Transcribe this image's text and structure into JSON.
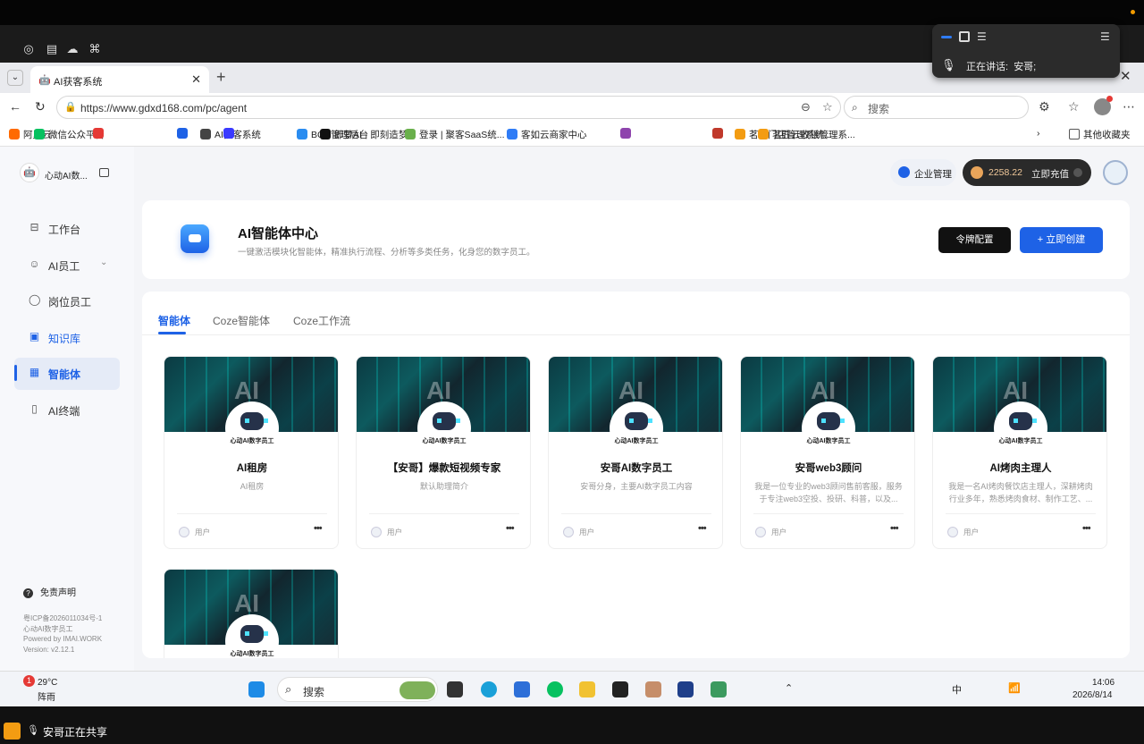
{
  "voice_popup": {
    "speaking_label": "正在讲话:",
    "speaker": "安哥;"
  },
  "tab": {
    "title": "AI获客系统"
  },
  "address": {
    "url": "https://www.gdxd168.com/pc/agent",
    "search_placeholder": "搜索"
  },
  "bookmarks": [
    {
      "label": "阿里云",
      "color": "#ff6a00"
    },
    {
      "label": "微信公众平台",
      "color": "#07c160"
    },
    {
      "label": "",
      "color": "#e53935"
    },
    {
      "label": "",
      "color": "#1e62e6"
    },
    {
      "label": "AI获客系统",
      "color": "#444"
    },
    {
      "label": "",
      "color": "#3a3aff"
    },
    {
      "label": "BCD管理后台",
      "color": "#2a8cf0"
    },
    {
      "label": "即梦AI - 即刻造梦",
      "color": "#111"
    },
    {
      "label": "登录 | 聚客SaaS统...",
      "color": "#6ab04c"
    },
    {
      "label": "客如云商家中心",
      "color": "#2f7cf6"
    },
    {
      "label": "",
      "color": "#8e44ad"
    },
    {
      "label": "",
      "color": "#c0392b"
    },
    {
      "label": "茗匠门店管理系统...",
      "color": "#f39c12"
    },
    {
      "label": "茗匠云收银管理系...",
      "color": "#f39c12"
    }
  ],
  "bookmarks_other": "其他收藏夹",
  "sidebar": {
    "brand": "心动AI数...",
    "items": [
      {
        "label": "工作台",
        "icon": "desk-icon"
      },
      {
        "label": "AI员工",
        "icon": "robot-icon"
      },
      {
        "label": "岗位员工",
        "icon": "bulb-icon"
      },
      {
        "label": "知识库",
        "icon": "book-icon"
      },
      {
        "label": "智能体",
        "icon": "grid-icon"
      },
      {
        "label": "AI终端",
        "icon": "phone-icon"
      }
    ],
    "disclaimer": "免责声明",
    "footer": [
      "粤ICP备2026011034号-1",
      "心动AI数字员工",
      "Powered by IMAI.WORK",
      "Version:  v2.12.1"
    ]
  },
  "header": {
    "enterprise": "企业管理",
    "balance": "2258.22",
    "recharge": "立即充值"
  },
  "hero": {
    "title": "AI智能体中心",
    "subtitle": "一键激活模块化智能体，精准执行流程、分析等多类任务，化身您的数字员工。",
    "token_btn": "令牌配置",
    "create_btn": "+ 立即创建"
  },
  "tabs": [
    "智能体",
    "Coze智能体",
    "Coze工作流"
  ],
  "robot_label": "心动AI数字员工",
  "cards": [
    {
      "name": "AI租房",
      "desc": "AI租房",
      "user": "用户"
    },
    {
      "name": "【安哥】爆款短视频专家",
      "desc": "默认助理简介",
      "user": "用户"
    },
    {
      "name": "安哥AI数字员工",
      "desc": "安哥分身，主要AI数字员工内容",
      "user": "用户"
    },
    {
      "name": "安哥web3顾问",
      "desc": "我是一位专业的web3顾问售前客服，服务于专注web3空投、投研、科普，以及...",
      "user": "用户"
    },
    {
      "name": "AI烤肉主理人",
      "desc": "我是一名AI烤肉餐饮店主理人，深耕烤肉行业多年，熟悉烤肉食材、制作工艺、...",
      "user": "用户"
    },
    {
      "name": "",
      "desc": "",
      "user": ""
    }
  ],
  "taskbar": {
    "badge": "1",
    "temp": "29°C",
    "weather": "阵雨",
    "search": "搜索",
    "time": "14:06",
    "date": "2026/8/14",
    "ime": "中"
  },
  "share": {
    "text": "安哥正在共享"
  }
}
